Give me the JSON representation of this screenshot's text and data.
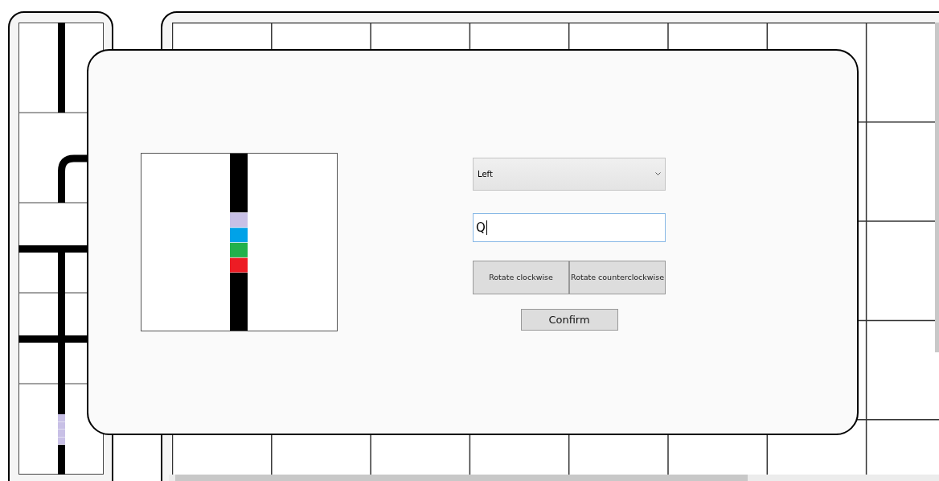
{
  "dialog": {
    "preview": {
      "segments": [
        {
          "color": "#c8c0e6"
        },
        {
          "color": "#00a2e8"
        },
        {
          "color": "#22b14c"
        },
        {
          "color": "#ed1c24"
        }
      ]
    },
    "direction_select": {
      "value": "Left"
    },
    "text_input": {
      "value": "Q"
    },
    "rotate_buttons": [
      "Rotate clockwise",
      "Rotate counterclockwise"
    ],
    "confirm_button": "Confirm"
  }
}
